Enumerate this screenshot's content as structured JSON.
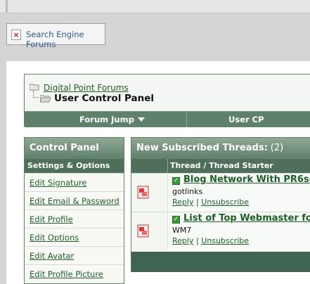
{
  "browser_tab": {
    "label": "Search Engine Forums",
    "icon": "broken-image-icon"
  },
  "breadcrumb": {
    "parent_link": "Digital Point Forums",
    "current": "User Control Panel"
  },
  "navbar": {
    "forum_jump": "Forum Jump",
    "user_cp": "User CP"
  },
  "control_panel": {
    "title": "Control Panel",
    "section": "Settings & Options",
    "items": [
      "Edit Signature",
      "Edit Email & Password",
      "Edit Profile",
      "Edit Options",
      "Edit Avatar",
      "Edit Profile Picture"
    ]
  },
  "threads": {
    "title": "New Subscribed Threads:",
    "count": "(2)",
    "column_header": "Thread / Thread Starter",
    "rows": [
      {
        "title": "Blog Network With PR6s-",
        "starter": "gotlinks",
        "reply": "Reply",
        "unsubscribe": "Unsubscribe",
        "sep": "|"
      },
      {
        "title": "List of Top Webmaster fo",
        "starter": "WM7",
        "reply": "Reply",
        "unsubscribe": "Unsubscribe",
        "sep": "|"
      }
    ]
  },
  "colors": {
    "accent_green": "#5f806b",
    "link_green": "#1e5e28"
  }
}
